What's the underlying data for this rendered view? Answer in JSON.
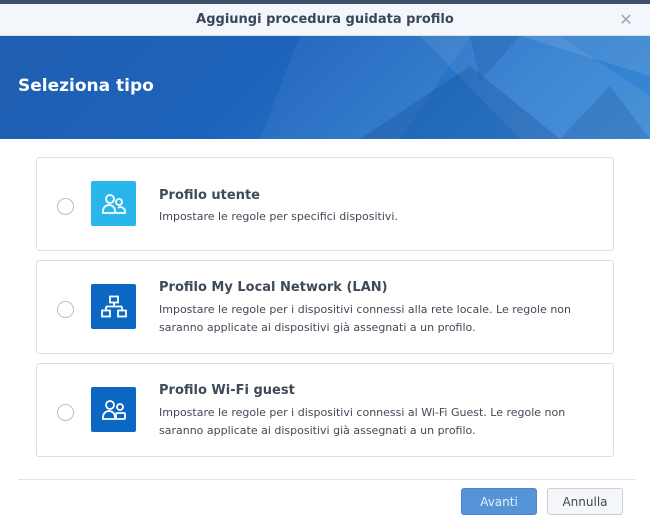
{
  "window": {
    "title": "Aggiungi procedura guidata profilo",
    "close_icon": "close-icon"
  },
  "banner": {
    "heading": "Seleziona tipo"
  },
  "options": [
    {
      "title": "Profilo utente",
      "desc_line1": "Impostare le regole per specifici dispositivi.",
      "desc_line2": "",
      "icon": "users-icon",
      "icon_color": "#2ab6ea",
      "selected": false
    },
    {
      "title": "Profilo My Local Network (LAN)",
      "desc_line1": "Impostare le regole per i dispositivi connessi alla rete locale. Le regole non",
      "desc_line2": "saranno applicate ai dispositivi già assegnati a un profilo.",
      "icon": "network-icon",
      "icon_color": "#0b67c2",
      "selected": false
    },
    {
      "title": "Profilo Wi-Fi guest",
      "desc_line1": "Impostare le regole per i dispositivi connessi al Wi-Fi Guest. Le regole non",
      "desc_line2": "saranno applicate ai dispositivi già assegnati a un profilo.",
      "icon": "guest-users-icon",
      "icon_color": "#0b67c2",
      "selected": false
    }
  ],
  "footer": {
    "next_label": "Avanti",
    "cancel_label": "Annulla"
  },
  "colors": {
    "banner": "#1d63bb",
    "primary_button": "#4e8fd6"
  }
}
